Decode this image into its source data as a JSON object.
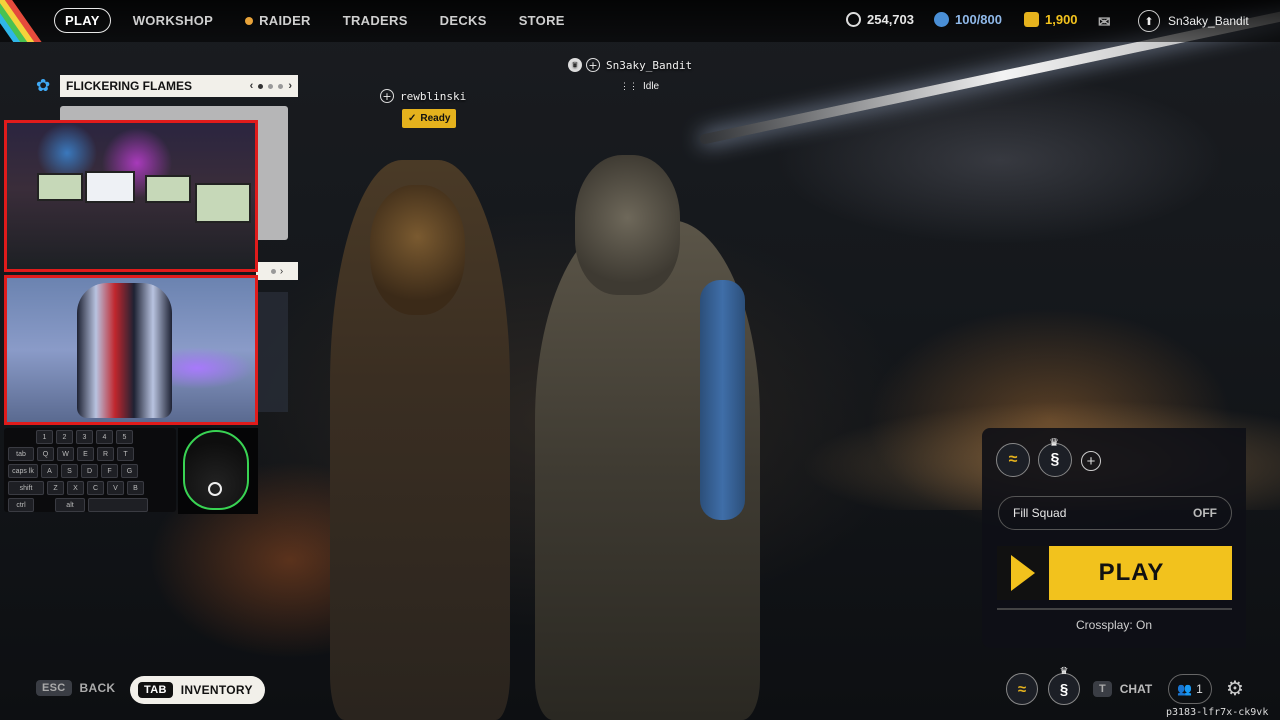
{
  "nav": {
    "items": [
      "PLAY",
      "WORKSHOP",
      "RAIDER",
      "TRADERS",
      "DECKS",
      "STORE"
    ],
    "active_index": 0
  },
  "currency": {
    "coins": "254,703",
    "capacity": "100/800",
    "gold": "1,900"
  },
  "user": {
    "name": "Sn3aky_Bandit"
  },
  "challenge": {
    "title": "FLICKERING FLAMES",
    "page_current": 1,
    "page_total": 3
  },
  "squad": {
    "members": [
      {
        "name": "rewblinski",
        "status": "Ready"
      },
      {
        "name": "Sn3aky_Bandit",
        "status": "Idle"
      }
    ]
  },
  "keyboard": {
    "rows": [
      [
        "1",
        "2",
        "3",
        "4",
        "5"
      ],
      [
        "tab",
        "Q",
        "W",
        "E",
        "R",
        "T"
      ],
      [
        "caps lk",
        "A",
        "S",
        "D",
        "F",
        "G"
      ],
      [
        "shift",
        "Z",
        "X",
        "C",
        "V",
        "B"
      ],
      [
        "ctrl",
        "alt"
      ]
    ]
  },
  "play_panel": {
    "fill_squad_label": "Fill Squad",
    "fill_squad_value": "OFF",
    "play_label": "PLAY",
    "crossplay": "Crossplay: On"
  },
  "bottom": {
    "back_key": "ESC",
    "back_label": "BACK",
    "inventory_key": "TAB",
    "inventory_label": "INVENTORY",
    "chat_key": "T",
    "chat_label": "CHAT",
    "party_count": "1",
    "build_id": "p3183-lfr7x-ck9vk"
  },
  "colors": {
    "accent_yellow": "#f2c21d",
    "webcam_border": "#e01b1b",
    "settings_blue": "#3fa9f5"
  }
}
